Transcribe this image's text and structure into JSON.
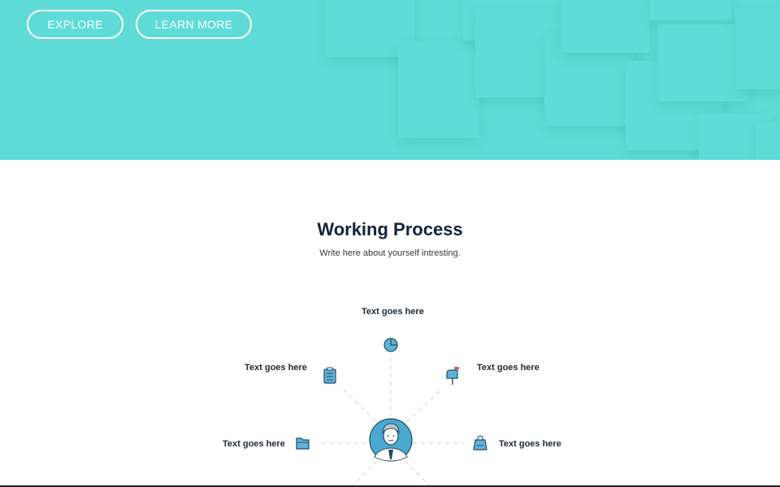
{
  "hero": {
    "background": "#5fdcd7",
    "buttons": {
      "explore": "EXPLORE",
      "learn_more": "LEARN MORE"
    }
  },
  "section": {
    "title": "Working Process",
    "subtitle": "Write here about yourself intresting."
  },
  "process": {
    "center_icon": "businessman-avatar-icon",
    "steps": [
      {
        "label": "Text goes here",
        "icon": "pie-chart-icon"
      },
      {
        "label": "Text goes here",
        "icon": "clipboard-checklist-icon"
      },
      {
        "label": "Text goes here",
        "icon": "mailbox-icon"
      },
      {
        "label": "Text goes here",
        "icon": "folder-icon"
      },
      {
        "label": "Text goes here",
        "icon": "shopping-bag-icon"
      }
    ],
    "colors": {
      "icon_fill": "#5fb4d6",
      "icon_stroke": "#234a68",
      "connector": "#c9d3da",
      "avatar_bg": "#4aa9d0"
    }
  }
}
